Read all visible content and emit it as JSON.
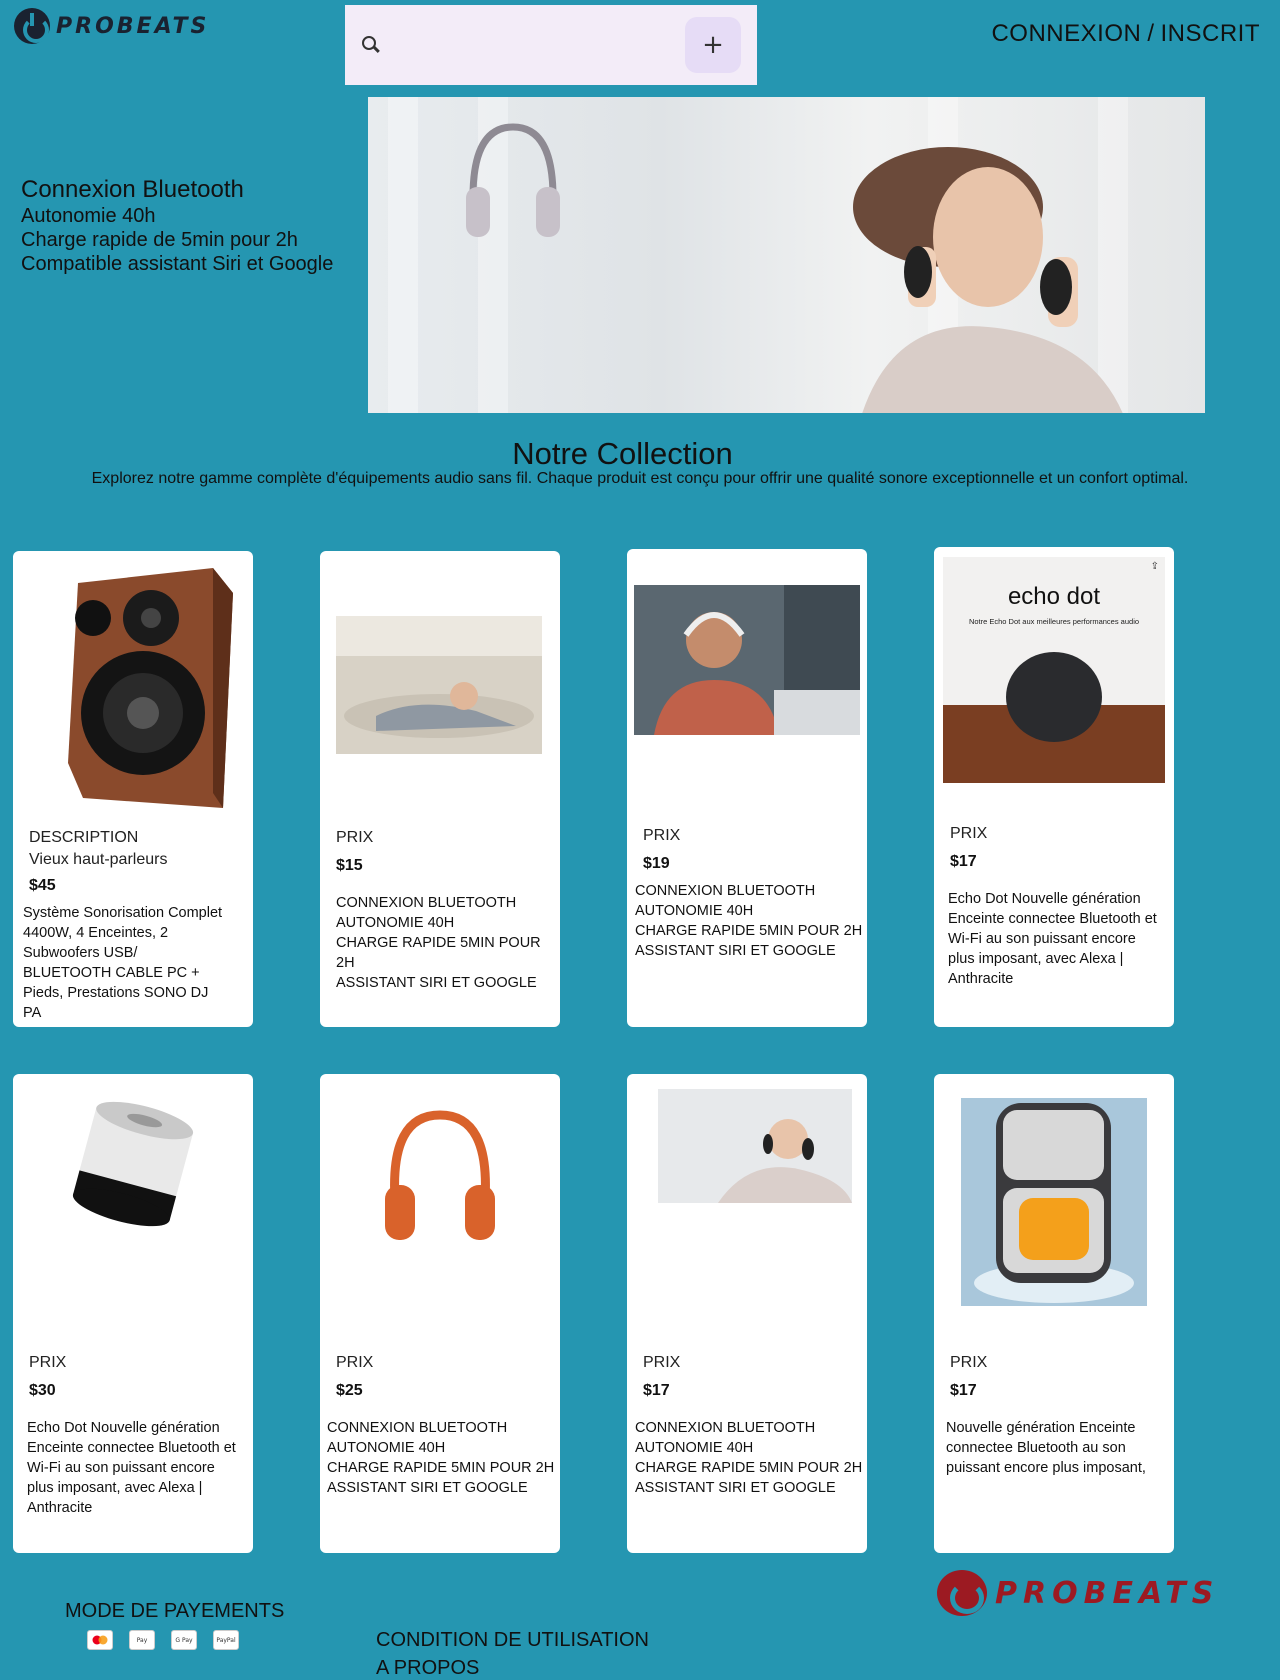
{
  "header": {
    "logo_text": "PROBEATS",
    "search_placeholder": "",
    "add_label": "+",
    "login_label": "CONNEXION",
    "separator": "/",
    "signup_label": "INSCRIT"
  },
  "hero": {
    "title": "Connexion Bluetooth",
    "lines": [
      "Autonomie 40h",
      "Charge rapide de 5min pour 2h",
      "Compatible assistant Siri et Google"
    ]
  },
  "collection": {
    "title": "Notre Collection",
    "subtitle": "Explorez notre gamme complète d'équipements audio sans fil. Chaque produit est conçu pour offrir une qualité sonore exceptionnelle et un confort optimal."
  },
  "products": [
    {
      "label": "DESCRIPTION",
      "subtitle": "Vieux haut-parleurs",
      "price": "$45",
      "desc": "Système Sonorisation Complet 4400W, 4 Enceintes, 2 Subwoofers USB/ BLUETOOTH CABLE PC + Pieds, Prestations SONO DJ PA"
    },
    {
      "label": "PRIX",
      "price": "$15",
      "desc": "CONNEXION BLUETOOTH\nAUTONOMIE 40H\nCHARGE RAPIDE 5MIN POUR 2H\nASSISTANT SIRI ET GOOGLE"
    },
    {
      "label": "PRIX",
      "price": "$19",
      "desc": "CONNEXION BLUETOOTH\nAUTONOMIE 40H\nCHARGE RAPIDE 5MIN POUR 2H\nASSISTANT SIRI ET GOOGLE"
    },
    {
      "label": "PRIX",
      "price": "$17",
      "desc": "Echo Dot Nouvelle génération\n Enceinte connectee Bluetooth et Wi-Fi au son puissant encore plus imposant, avec Alexa | Anthracite",
      "img_title": "echo dot",
      "img_sub": "Notre Echo Dot aux meilleures performances audio"
    },
    {
      "label": "PRIX",
      "price": "$30",
      "desc": "Echo Dot Nouvelle génération\n Enceinte connectee Bluetooth et Wi-Fi au son puissant encore plus imposant, avec Alexa | Anthracite"
    },
    {
      "label": "PRIX",
      "price": "$25",
      "desc": "CONNEXION BLUETOOTH\nAUTONOMIE 40H\nCHARGE RAPIDE 5MIN POUR 2H\nASSISTANT SIRI ET GOOGLE"
    },
    {
      "label": "PRIX",
      "price": "$17",
      "desc": "CONNEXION BLUETOOTH\nAUTONOMIE 40H\nCHARGE RAPIDE 5MIN POUR 2H\nASSISTANT SIRI ET GOOGLE"
    },
    {
      "label": "PRIX",
      "price": "$17",
      "desc": "Nouvelle génération Enceinte connectee Bluetooth au son puissant encore plus imposant,"
    }
  ],
  "footer": {
    "payment_title": "MODE DE PAYEMENTS",
    "payment_icons": [
      "mastercard-icon",
      "apple-pay-icon",
      "google-pay-icon",
      "paypal-icon"
    ],
    "payment_icon_labels": [
      "",
      "Pay",
      "G Pay",
      "PayPal"
    ],
    "terms_link": "CONDITION DE UTILISATION",
    "about_link": "A PROPOS",
    "logo_text": "PROBEATS"
  },
  "colors": {
    "background": "#2596b1",
    "search_bg": "#f3ecf8",
    "add_button_bg": "#e6dcf6",
    "footer_logo": "#9c1a22"
  }
}
